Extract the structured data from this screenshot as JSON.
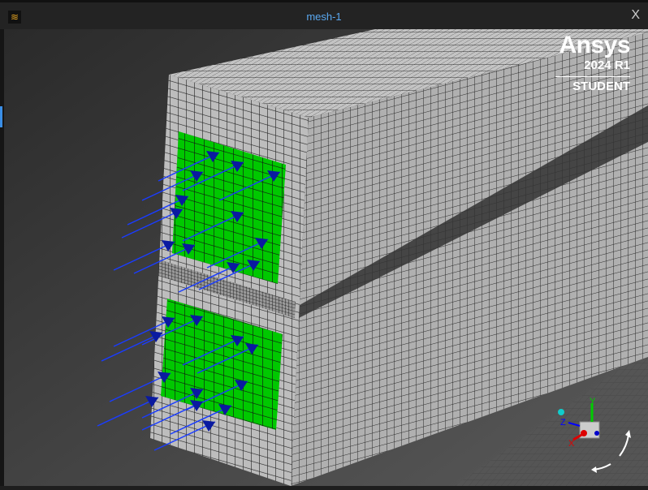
{
  "window": {
    "title": "mesh-1",
    "close_label": "X",
    "app_icon": "ansys-fluent-icon"
  },
  "logo": {
    "brand": "Ansys",
    "version": "2024 R1",
    "edition": "STUDENT"
  },
  "triad": {
    "x_label": "X",
    "y_label": "Y",
    "z_label": "Z"
  },
  "colors": {
    "mesh_face": "#b8b8b8",
    "boundary": "#00cc00",
    "vectors": "#0a1aa0",
    "title": "#5aa8f0"
  }
}
